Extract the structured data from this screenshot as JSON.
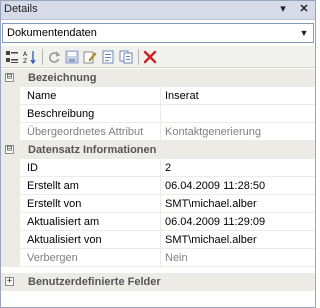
{
  "panel": {
    "title": "Details",
    "pin_icon": "pin-dropdown-icon",
    "close_icon": "close-icon"
  },
  "selector": {
    "value": "Dokumentendaten"
  },
  "toolbar": {
    "buttons": [
      "categorized-view-icon",
      "alphabetical-sort-icon",
      "refresh-icon",
      "save-icon",
      "edit-icon",
      "document-icon",
      "copy-icon",
      "delete-icon"
    ]
  },
  "grid": {
    "categories": [
      {
        "label": "Bezeichnung",
        "expanded": true,
        "rows": [
          {
            "name": "Name",
            "value": "Inserat",
            "readonly": false
          },
          {
            "name": "Beschreibung",
            "value": "",
            "readonly": false
          },
          {
            "name": "Übergeordnetes Attribut",
            "value": "Kontaktgenerierung",
            "readonly": true
          }
        ]
      },
      {
        "label": "Datensatz Informationen",
        "expanded": true,
        "rows": [
          {
            "name": "ID",
            "value": "2",
            "readonly": false
          },
          {
            "name": "Erstellt am",
            "value": "06.04.2009 11:28:50",
            "readonly": false
          },
          {
            "name": "Erstellt von",
            "value": "SMT\\michael.alber",
            "readonly": false
          },
          {
            "name": "Aktualisiert am",
            "value": "06.04.2009 11:29:09",
            "readonly": false
          },
          {
            "name": "Aktualisiert von",
            "value": "SMT\\michael.alber",
            "readonly": false
          },
          {
            "name": "Verbergen",
            "value": "Nein",
            "readonly": true
          }
        ]
      },
      {
        "label": "Benutzerdefinierte Felder",
        "expanded": false,
        "rows": []
      }
    ],
    "toggle_expanded": "⊟",
    "toggle_collapsed": "+"
  }
}
